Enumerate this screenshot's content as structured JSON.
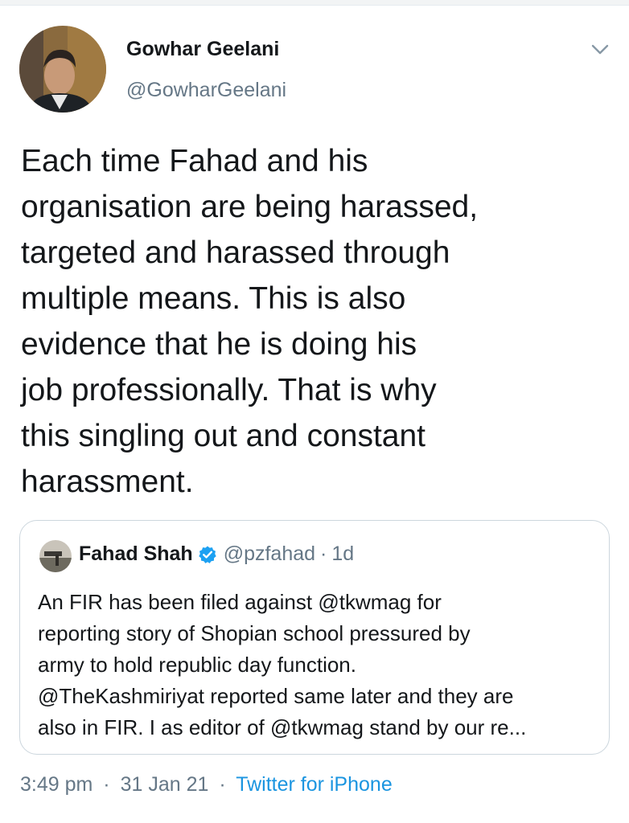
{
  "author": {
    "name": "Gowhar Geelani",
    "handle": "@GowharGeelani"
  },
  "tweet": {
    "lines": [
      "Each time Fahad and his",
      "organisation are being harassed,",
      "targeted and harassed through",
      "multiple means. This is also",
      "evidence that he is doing his",
      "job professionally. That is why",
      "this singling out and constant",
      "harassment."
    ]
  },
  "quoted": {
    "name": "Fahad Shah",
    "handle": "@pzfahad",
    "separator": "·",
    "time": "1d",
    "lines": [
      "An FIR has been filed against @tkwmag for",
      "reporting story of Shopian school pressured by",
      "army to hold republic day function.",
      "@TheKashmiriyat reported same later and they are",
      "also in FIR. I as editor of @tkwmag stand by our re..."
    ]
  },
  "meta": {
    "time": "3:49 pm",
    "separator": "·",
    "date": "31 Jan 21",
    "source": "Twitter for iPhone"
  },
  "colors": {
    "text": "#14171a",
    "secondary": "#657786",
    "link": "#1b95e0",
    "verified": "#1da1f2",
    "border": "#ccd6dd"
  },
  "icons": {
    "caret": "chevron-down-icon",
    "verified": "verified-badge-icon"
  }
}
